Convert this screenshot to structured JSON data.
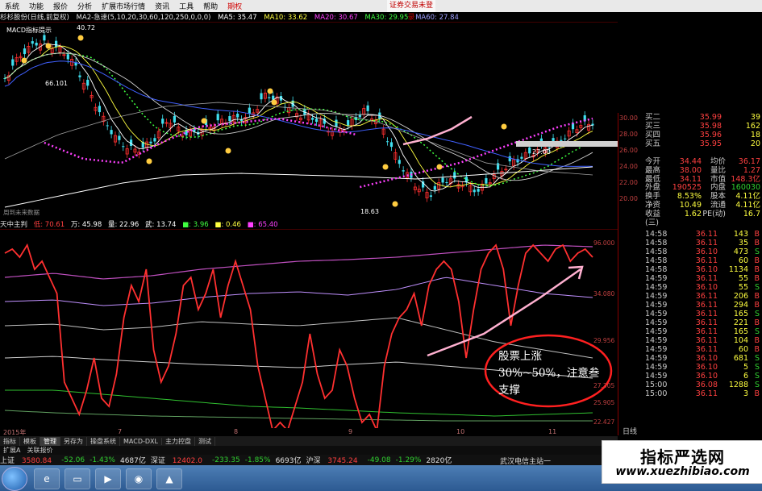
{
  "menubar": {
    "items": [
      "系统",
      "功能",
      "报价",
      "分析",
      "扩展市场行情",
      "资讯",
      "工具",
      "帮助"
    ],
    "active": "期权",
    "login": "证券交易未登录"
  },
  "ma_line": {
    "title": "杉杉股份(日线,前复权)",
    "ma_params": "MA2-急速(5,10,20,30,60,120,250,0,0,0)",
    "items": [
      {
        "label": "MA5: 35.47",
        "color": "#ffffff"
      },
      {
        "label": "MA10: 33.62",
        "color": "#ffff40"
      },
      {
        "label": "MA20: 30.67",
        "color": "#ff40ff"
      },
      {
        "label": "MA30: 29.95",
        "color": "#40ff40"
      },
      {
        "label": "MA60: 27.84",
        "color": "#a0a0ff"
      }
    ]
  },
  "kchart_labels": {
    "macd": "MACD指标提示",
    "val1": "40.72",
    "low": "18.63",
    "bottom": "周到未来数据",
    "val2": "66.101"
  },
  "price_axis": [
    "30.00",
    "28.00",
    "26.00",
    "24.00",
    "22.00",
    "20.00"
  ],
  "price_marker": "27.00",
  "indicator_line": {
    "name": "天中主判",
    "items": [
      {
        "label": "低: 70.61",
        "color": "#ff4040"
      },
      {
        "label": "万: 45.98",
        "color": "#ffffff"
      },
      {
        "label": "量: 22.96",
        "color": "#ffffff"
      },
      {
        "label": "武: 13.74",
        "color": "#ffffff"
      },
      {
        "label": "■: 3.96",
        "color": "#40ff40"
      },
      {
        "label": "■: 0.46",
        "color": "#ffff40"
      },
      {
        "label": "■: 65.40",
        "color": "#ff40ff"
      }
    ]
  },
  "ind_axis": [
    "96.000",
    "34.080",
    "29.956",
    "27.305",
    "25.905",
    "22.427"
  ],
  "xaxis": [
    "2015年",
    "7",
    "8",
    "9",
    "10",
    "11"
  ],
  "annotation": "股票上涨30%~50%，注意叁支撑",
  "tabs": [
    "指标",
    "模板",
    "管理",
    "另存为",
    "操盘系统",
    "MACD-DXL",
    "主力控盘",
    "测试"
  ],
  "tabs_active": "管理",
  "tabs2": [
    "扩展A",
    "关联报价"
  ],
  "status": [
    {
      "label": "上证",
      "value": "3580.84",
      "cls": "up"
    },
    {
      "label": "",
      "value": "-52.06",
      "cls": "dn"
    },
    {
      "label": "",
      "value": "-1.43%",
      "cls": "dn"
    },
    {
      "label": "",
      "value": "4687亿",
      "cls": "wh"
    },
    {
      "label": "深证",
      "value": "12402.0",
      "cls": "up"
    },
    {
      "label": "",
      "value": "-233.35",
      "cls": "dn"
    },
    {
      "label": "",
      "value": "-1.85%",
      "cls": "dn"
    },
    {
      "label": "",
      "value": "6693亿",
      "cls": "wh"
    },
    {
      "label": "沪深",
      "value": "3745.24",
      "cls": "up"
    },
    {
      "label": "",
      "value": "-49.08",
      "cls": "dn"
    },
    {
      "label": "",
      "value": "-1.29%",
      "cls": "dn"
    },
    {
      "label": "",
      "value": "2820亿",
      "cls": "wh"
    }
  ],
  "wuhan": "武汉电信主站一",
  "quotes": [
    {
      "label": "买二",
      "price": "35.99",
      "vol": "39"
    },
    {
      "label": "买三",
      "price": "35.98",
      "vol": "162"
    },
    {
      "label": "买四",
      "price": "35.96",
      "vol": "18"
    },
    {
      "label": "买五",
      "price": "35.95",
      "vol": "20"
    }
  ],
  "info": [
    {
      "l": "今开",
      "v": "34.44",
      "vc": "up",
      "l2": "均价",
      "v2": "36.17",
      "v2c": "up"
    },
    {
      "l": "最高",
      "v": "38.00",
      "vc": "up",
      "l2": "量比",
      "v2": "1.27",
      "v2c": "up"
    },
    {
      "l": "最低",
      "v": "34.11",
      "vc": "up",
      "l2": "市值",
      "v2": "148.3亿",
      "v2c": "up"
    },
    {
      "l": "外盘",
      "v": "190525",
      "vc": "up",
      "l2": "内盘",
      "v2": "160030",
      "v2c": "dn"
    },
    {
      "l": "换手",
      "v": "8.53%",
      "vc": "yl",
      "l2": "股本",
      "v2": "4.11亿",
      "v2c": "yl"
    },
    {
      "l": "净资",
      "v": "10.49",
      "vc": "yl",
      "l2": "流通",
      "v2": "4.11亿",
      "v2c": "yl"
    },
    {
      "l": "收益(三)",
      "v": "1.62",
      "vc": "yl",
      "l2": "PE(动)",
      "v2": "16.7",
      "v2c": "yl"
    }
  ],
  "ticks": [
    {
      "t": "14:58",
      "p": "36.11",
      "q": "143",
      "s": "B"
    },
    {
      "t": "14:58",
      "p": "36.11",
      "q": "35",
      "s": "B"
    },
    {
      "t": "14:58",
      "p": "36.10",
      "q": "473",
      "s": "S"
    },
    {
      "t": "14:58",
      "p": "36.11",
      "q": "60",
      "s": "B"
    },
    {
      "t": "14:58",
      "p": "36.10",
      "q": "1134",
      "s": "B"
    },
    {
      "t": "14:59",
      "p": "36.11",
      "q": "55",
      "s": "B"
    },
    {
      "t": "14:59",
      "p": "36.10",
      "q": "55",
      "s": "S"
    },
    {
      "t": "14:59",
      "p": "36.11",
      "q": "206",
      "s": "B"
    },
    {
      "t": "14:59",
      "p": "36.11",
      "q": "294",
      "s": "B"
    },
    {
      "t": "14:59",
      "p": "36.11",
      "q": "165",
      "s": "S"
    },
    {
      "t": "14:59",
      "p": "36.11",
      "q": "221",
      "s": "B"
    },
    {
      "t": "14:59",
      "p": "36.11",
      "q": "165",
      "s": "S"
    },
    {
      "t": "14:59",
      "p": "36.11",
      "q": "104",
      "s": "B"
    },
    {
      "t": "14:59",
      "p": "36.11",
      "q": "60",
      "s": "B"
    },
    {
      "t": "14:59",
      "p": "36.10",
      "q": "681",
      "s": "S"
    },
    {
      "t": "14:59",
      "p": "36.10",
      "q": "5",
      "s": "S"
    },
    {
      "t": "14:59",
      "p": "36.10",
      "q": "6",
      "s": "S"
    },
    {
      "t": "15:00",
      "p": "36.08",
      "q": "1288",
      "s": "S"
    },
    {
      "t": "15:00",
      "p": "36.11",
      "q": "3",
      "s": "B"
    }
  ],
  "right_tab": "日线",
  "watermark": {
    "title": "指标严选网",
    "url": "www.xuezhibiao.com"
  }
}
